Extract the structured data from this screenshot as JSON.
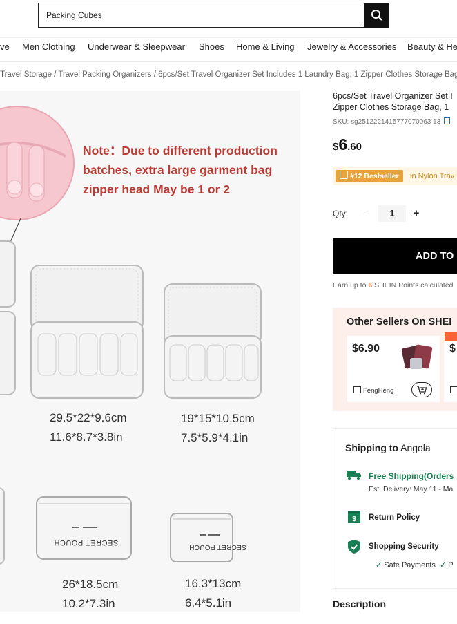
{
  "search": {
    "value": "Packing Cubes"
  },
  "nav": {
    "items": [
      "ve",
      "Men Clothing",
      "Underwear & Sleepwear",
      "Shoes",
      "Home & Living",
      "Jewelry & Accessories",
      "Beauty & He"
    ]
  },
  "breadcrumb": {
    "items": [
      "Travel Storage",
      "Travel Packing Organizers",
      "6pcs/Set Travel Organizer Set Includes 1 Laundry Bag, 1 Zipper Clothes Storage Bag, 1"
    ],
    "separator": "/"
  },
  "image": {
    "note_lines": [
      "Note：Due to different production",
      "batches, extra large garment bag",
      "zipper head May be 1 or 2"
    ],
    "pouch_label": "SECRET POUCH",
    "sizes": [
      {
        "cm": "29.5*22*9.6cm",
        "in": "11.6*8.7*3.8in"
      },
      {
        "cm": "19*15*10.5cm",
        "in": "7.5*5.9*4.1in"
      },
      {
        "cm": "26*18.5cm",
        "in": "10.2*7.3in"
      },
      {
        "cm": "16.3*13cm",
        "in": "6.4*5.1in"
      }
    ]
  },
  "product": {
    "title_line1": "6pcs/Set Travel Organizer Set I",
    "title_line2": "Zipper Clothes Storage Bag, 1",
    "sku": "SKU: sg2512221415777070063 13",
    "price_currency": "$",
    "price_whole": "6",
    "price_cents": ".60",
    "bestseller_label": "#12 Bestseller",
    "bestseller_category": "in Nylon Trav"
  },
  "quantity": {
    "label": "Qty:",
    "minus": "−",
    "value": "1",
    "plus": "+"
  },
  "cart": {
    "add_label": "ADD TO C",
    "earn_prefix": "Earn up to ",
    "earn_points": "6",
    "earn_suffix": " SHEIN Points calculated"
  },
  "other_sellers": {
    "title": "Other Sellers On SHEI",
    "cards": [
      {
        "price": "$6.90",
        "seller": "FengHeng"
      },
      {
        "price": "$"
      }
    ]
  },
  "shipping": {
    "title_bold": "Shipping to",
    "destination": " Angola",
    "free_label": "Free Shipping(Orders",
    "est_delivery": "Est. Delivery: May 11 - Ma",
    "return_policy": "Return Policy",
    "security_title": "Shopping Security",
    "safe_payments": "Safe Payments",
    "safe_more": "P"
  },
  "description": {
    "label": "Description"
  },
  "colors": {
    "accent": "#fa6338",
    "green": "#198055",
    "badge": "#e6a23c",
    "note_red": "#b93b33"
  }
}
